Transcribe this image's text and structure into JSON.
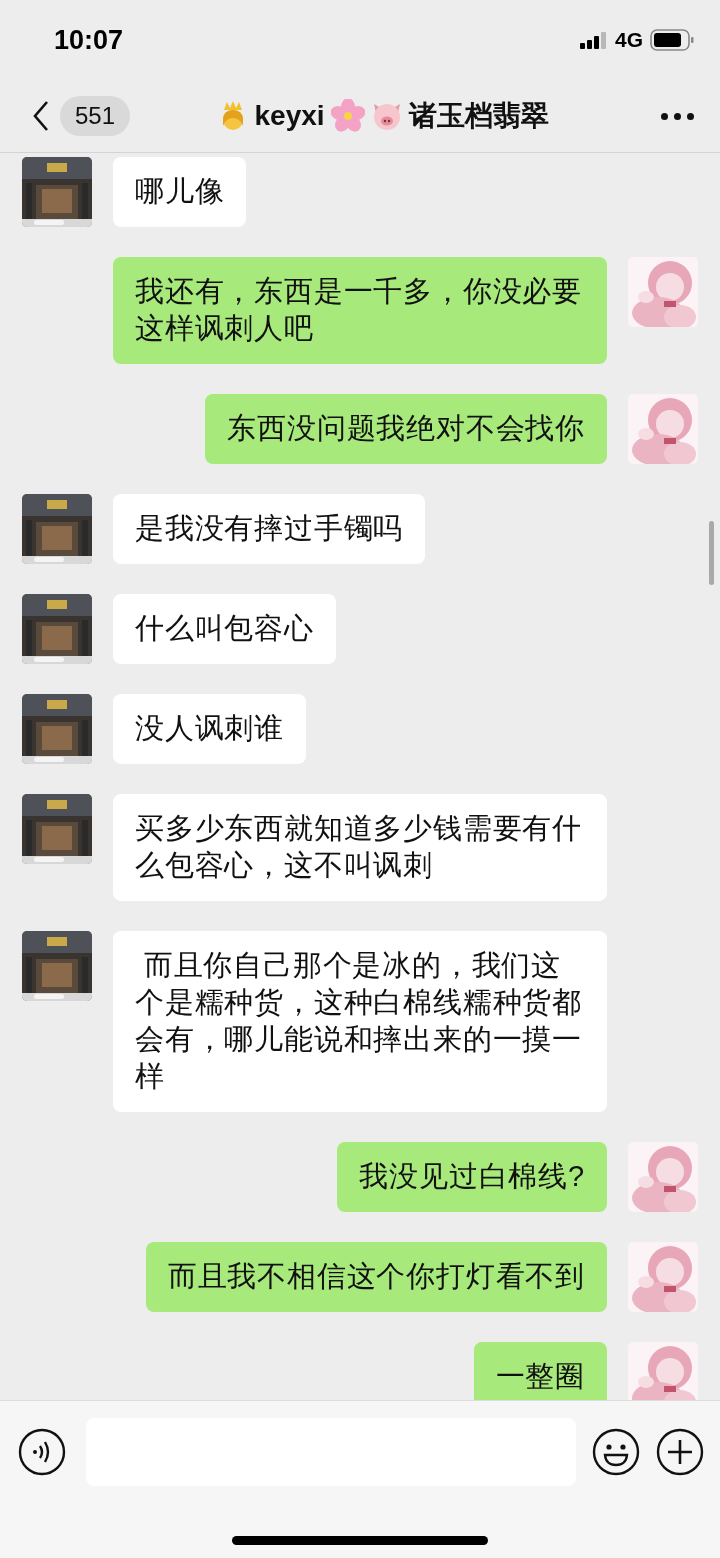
{
  "status_bar": {
    "time": "10:07",
    "network": "4G"
  },
  "header": {
    "back_count": "551",
    "title_name": "keyxi",
    "title_shop": "诸玉档翡翠"
  },
  "messages": [
    {
      "kind": "incoming",
      "text": "哪儿像"
    },
    {
      "kind": "outgoing",
      "text": "我还有，东西是一千多，你没必要这样讽刺人吧"
    },
    {
      "kind": "outgoing",
      "text": "东西没问题我绝对不会找你"
    },
    {
      "kind": "incoming",
      "text": "是我没有摔过手镯吗"
    },
    {
      "kind": "incoming",
      "text": "什么叫包容心"
    },
    {
      "kind": "incoming",
      "text": "没人讽刺谁"
    },
    {
      "kind": "incoming",
      "text": "买多少东西就知道多少钱需要有什么包容心，这不叫讽刺"
    },
    {
      "kind": "incoming",
      "text": " 而且你自己那个是冰的，我们这个是糯种货，这种白棉线糯种货都会有，哪儿能说和摔出来的一摸一样"
    },
    {
      "kind": "outgoing",
      "text": "我没见过白棉线?"
    },
    {
      "kind": "outgoing",
      "text": "而且我不相信这个你打灯看不到"
    },
    {
      "kind": "outgoing",
      "text": "一整圈"
    }
  ]
}
